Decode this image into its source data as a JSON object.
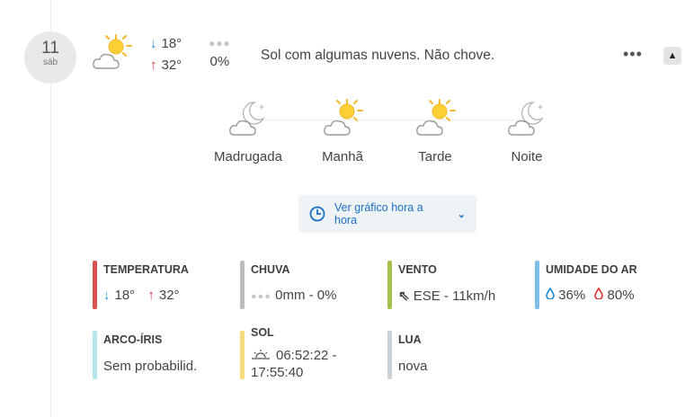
{
  "date": {
    "day": "11",
    "weekday": "sáb"
  },
  "summary_row": {
    "icon": "sun-cloud-icon",
    "temp_min": "18°",
    "temp_max": "32°",
    "rain_probability": "0%",
    "description": "Sol com algumas nuvens. Não chove.",
    "more_label": "•••",
    "collapse_label": "▲"
  },
  "periods": [
    {
      "label": "Madrugada",
      "icon": "moon-cloud-icon"
    },
    {
      "label": "Manhã",
      "icon": "sun-cloud-icon"
    },
    {
      "label": "Tarde",
      "icon": "sun-cloud-icon"
    },
    {
      "label": "Noite",
      "icon": "moon-cloud-icon"
    }
  ],
  "hourly_button": {
    "label": "Ver gráfico hora a hora"
  },
  "stats": {
    "temperatura": {
      "title": "TEMPERATURA",
      "min": "18°",
      "max": "32°",
      "color": "#d9534f"
    },
    "chuva": {
      "title": "CHUVA",
      "value": "0mm - 0%",
      "color": "#bdbdbd"
    },
    "vento": {
      "title": "VENTO",
      "value": "ESE - 11km/h",
      "color": "#a5c04a"
    },
    "umidade": {
      "title": "UMIDADE DO AR",
      "min": "36%",
      "max": "80%",
      "color": "#7fbde6"
    },
    "arco_iris": {
      "title": "ARCO-ÍRIS",
      "value": "Sem probabilid.",
      "color": "#b5e8ec"
    },
    "sol": {
      "title": "SOL",
      "value_line1": "06:52:22 -",
      "value_line2": "17:55:40",
      "color": "#f4dc7c"
    },
    "lua": {
      "title": "LUA",
      "value": "nova",
      "color": "#c9d0d6"
    }
  }
}
